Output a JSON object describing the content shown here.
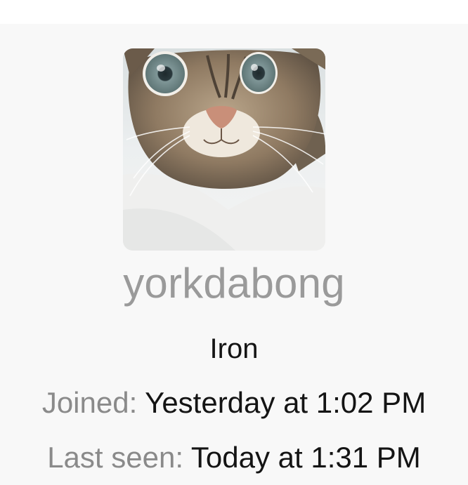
{
  "profile": {
    "username": "yorkdabong",
    "rank": "Iron",
    "joined_label": "Joined:",
    "joined_value": "Yesterday at 1:02 PM",
    "last_seen_label": "Last seen:",
    "last_seen_value": "Today at 1:31 PM",
    "avatar_icon": "cat-photo-avatar"
  },
  "colors": {
    "card_background": "#f8f8f8",
    "username": "#9a9a9a",
    "label": "#8a8a8a",
    "value": "#141414"
  }
}
